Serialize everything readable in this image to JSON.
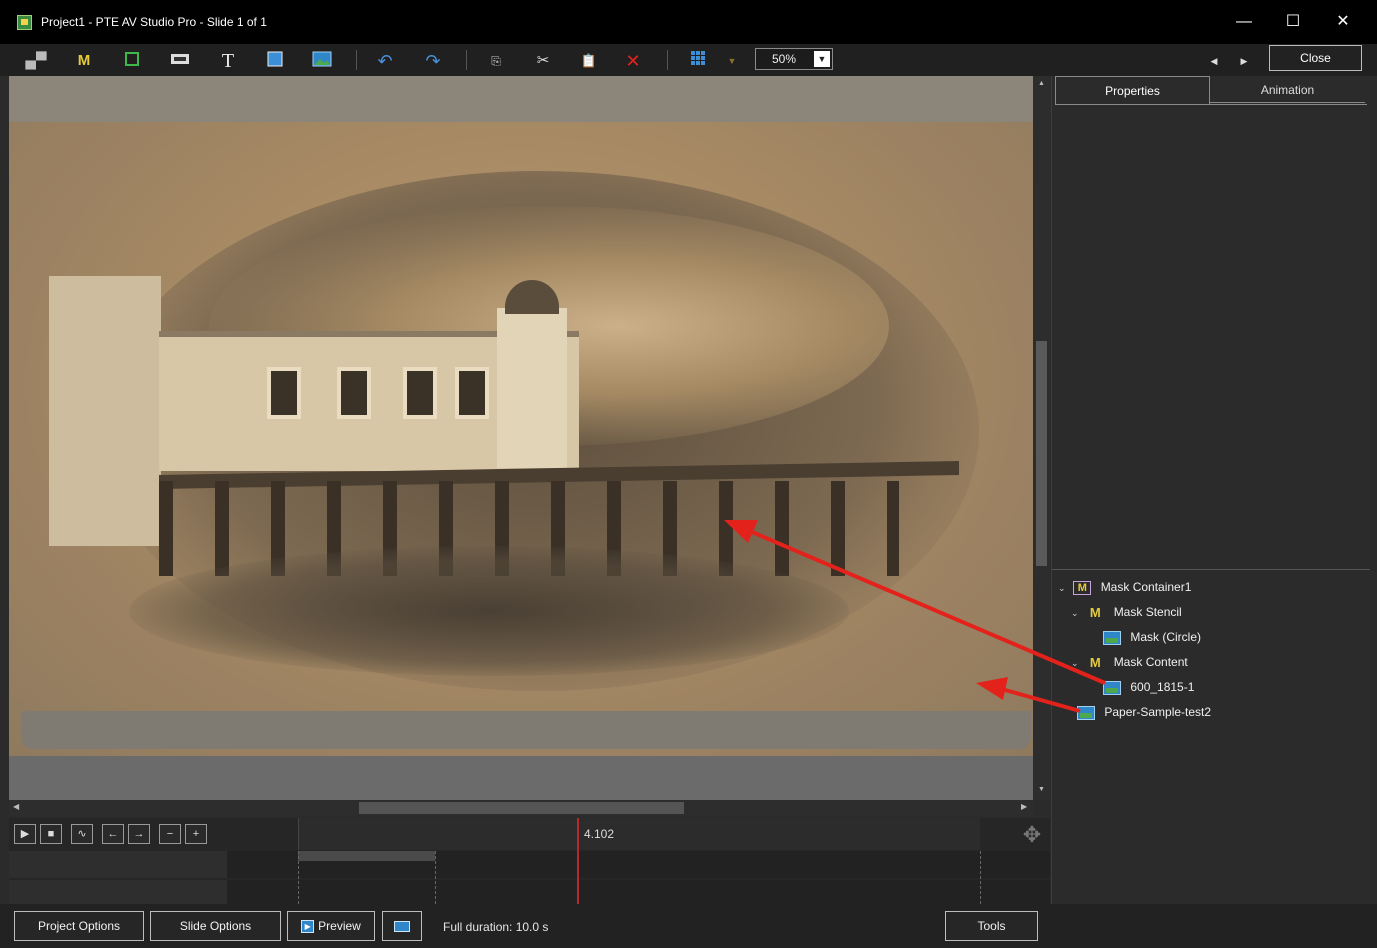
{
  "window": {
    "title": "Project1 - PTE AV Studio Pro - Slide 1 of 1",
    "controls": {
      "minimize": "—",
      "maximize": "☐",
      "close": "✕"
    }
  },
  "toolbar": {
    "zoom_value": "50%",
    "close_label": "Close",
    "icons": [
      "camera-icon",
      "mask-icon",
      "frame-icon",
      "button-icon",
      "text-icon",
      "rectangle-icon",
      "image-icon",
      "undo-icon",
      "redo-icon",
      "paste-copy-icon",
      "cut-icon",
      "paste-icon",
      "delete-icon",
      "grid-icon",
      "grid-dropdown-icon",
      "prev-icon",
      "next-icon"
    ]
  },
  "panel": {
    "tabs": [
      {
        "label": "Properties"
      },
      {
        "label": "Animation"
      }
    ],
    "tree": [
      {
        "label": "Mask Container1",
        "icon": "mask-container-icon"
      },
      {
        "label": "Mask Stencil",
        "icon": "mask-stencil-icon"
      },
      {
        "label": "Mask (Circle)",
        "icon": "image-icon"
      },
      {
        "label": "Mask Content",
        "icon": "mask-content-icon"
      },
      {
        "label": "600_1815-1",
        "icon": "image-icon"
      },
      {
        "label": "Paper-Sample-test2",
        "icon": "image-icon"
      }
    ]
  },
  "timeline": {
    "current_time": "4.102",
    "buttons": [
      "play-icon",
      "stop-icon",
      "waveform-icon",
      "step-back-icon",
      "step-forward-icon",
      "zoom-out-icon",
      "zoom-in-icon"
    ]
  },
  "bottombar": {
    "project_options": "Project Options",
    "slide_options": "Slide Options",
    "preview": "Preview",
    "duration": "Full duration: 10.0 s",
    "tools": "Tools"
  },
  "colors": {
    "annotation_arrow": "#e3221c",
    "playhead": "#b52a2a",
    "background": "#2b2b2b"
  }
}
